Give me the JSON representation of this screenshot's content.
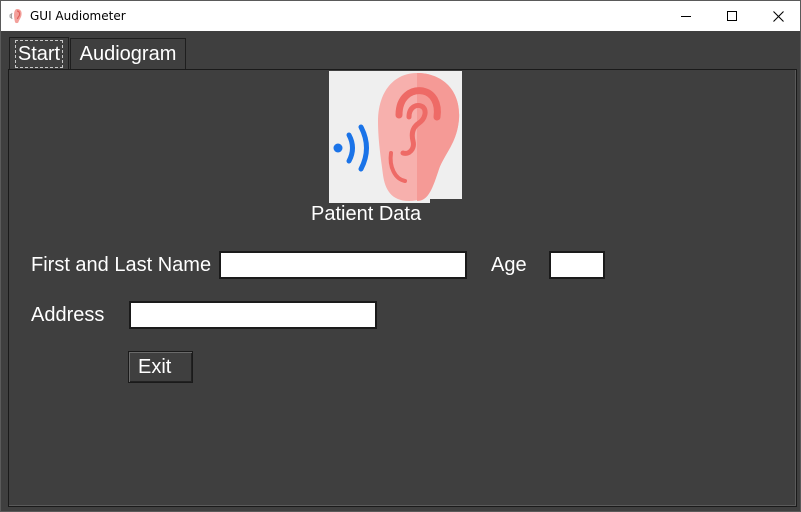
{
  "window": {
    "title": "GUI Audiometer",
    "app_icon": "ear-sound-icon",
    "controls": {
      "minimize": "minimize-icon",
      "maximize": "maximize-icon",
      "close": "close-icon"
    }
  },
  "tabs": [
    {
      "label": "Start",
      "selected": true
    },
    {
      "label": "Audiogram",
      "selected": false
    }
  ],
  "logo": {
    "icon": "ear-hearing-logo",
    "colors": {
      "background": "#efefef",
      "ear": "#f6a6a3",
      "ear_inner": "#ef7d79",
      "waves": "#1a73e8"
    }
  },
  "form": {
    "section_title": "Patient Data",
    "name_label": "First and Last Name",
    "name_value": "",
    "age_label": "Age",
    "age_value": "",
    "address_label": "Address",
    "address_value": "",
    "exit_label": "Exit"
  },
  "colors": {
    "window_bg": "#3f3f3f",
    "text": "#ffffff",
    "input_bg": "#ffffff"
  }
}
